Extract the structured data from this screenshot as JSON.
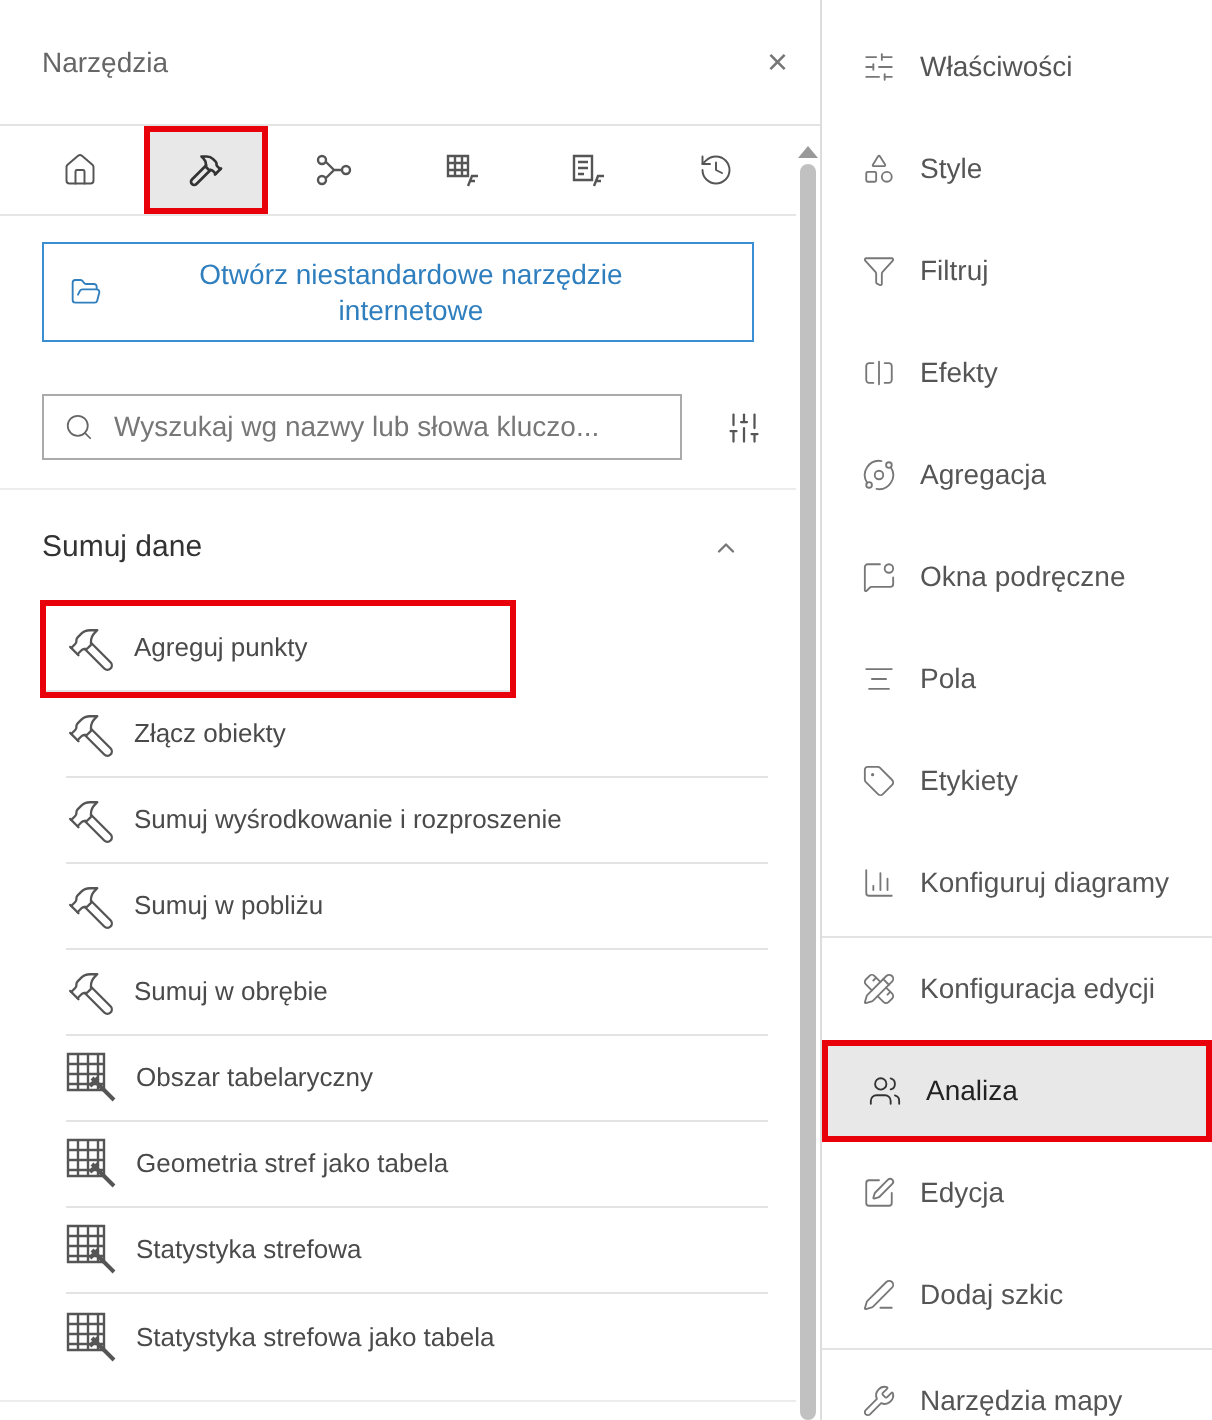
{
  "panel": {
    "title": "Narzędzia",
    "close": "×"
  },
  "tabs": [
    {
      "kind": "home",
      "selected": false,
      "highlighted": false
    },
    {
      "kind": "hammer",
      "selected": true,
      "highlighted": true
    },
    {
      "kind": "nodes",
      "selected": false,
      "highlighted": false
    },
    {
      "kind": "table-fx",
      "selected": false,
      "highlighted": false
    },
    {
      "kind": "list-fx",
      "selected": false,
      "highlighted": false
    },
    {
      "kind": "history",
      "selected": false,
      "highlighted": false
    }
  ],
  "open_button": "Otwórz niestandardowe narzędzie internetowe",
  "search": {
    "placeholder": "Wyszukaj wg nazwy lub słowa kluczo..."
  },
  "section": {
    "title": "Sumuj dane",
    "expanded": true,
    "items": [
      {
        "label": "Agreguj punkty",
        "kind": "hammer",
        "highlighted": true
      },
      {
        "label": "Złącz obiekty",
        "kind": "hammer",
        "highlighted": false
      },
      {
        "label": "Sumuj wyśrodkowanie i rozproszenie",
        "kind": "hammer",
        "highlighted": false
      },
      {
        "label": "Sumuj w pobliżu",
        "kind": "hammer",
        "highlighted": false
      },
      {
        "label": "Sumuj w obrębie",
        "kind": "hammer",
        "highlighted": false
      },
      {
        "label": "Obszar tabelaryczny",
        "kind": "table",
        "highlighted": false
      },
      {
        "label": "Geometria stref jako tabela",
        "kind": "table",
        "highlighted": false
      },
      {
        "label": "Statystyka strefowa",
        "kind": "table",
        "highlighted": false
      },
      {
        "label": "Statystyka strefowa jako tabela",
        "kind": "table",
        "highlighted": false
      }
    ]
  },
  "sidebar": {
    "groups": [
      [
        {
          "label": "Właściwości",
          "selected": false,
          "highlighted": false
        },
        {
          "label": "Style",
          "selected": false,
          "highlighted": false
        },
        {
          "label": "Filtruj",
          "selected": false,
          "highlighted": false
        },
        {
          "label": "Efekty",
          "selected": false,
          "highlighted": false
        },
        {
          "label": "Agregacja",
          "selected": false,
          "highlighted": false
        },
        {
          "label": "Okna podręczne",
          "selected": false,
          "highlighted": false
        },
        {
          "label": "Pola",
          "selected": false,
          "highlighted": false
        },
        {
          "label": "Etykiety",
          "selected": false,
          "highlighted": false
        },
        {
          "label": "Konfiguruj diagramy",
          "selected": false,
          "highlighted": false
        }
      ],
      [
        {
          "label": "Konfiguracja edycji",
          "selected": false,
          "highlighted": false
        },
        {
          "label": "Analiza",
          "selected": true,
          "highlighted": true
        },
        {
          "label": "Edycja",
          "selected": false,
          "highlighted": false
        },
        {
          "label": "Dodaj szkic",
          "selected": false,
          "highlighted": false
        }
      ],
      [
        {
          "label": "Narzędzia mapy",
          "selected": false,
          "highlighted": false
        }
      ]
    ]
  }
}
